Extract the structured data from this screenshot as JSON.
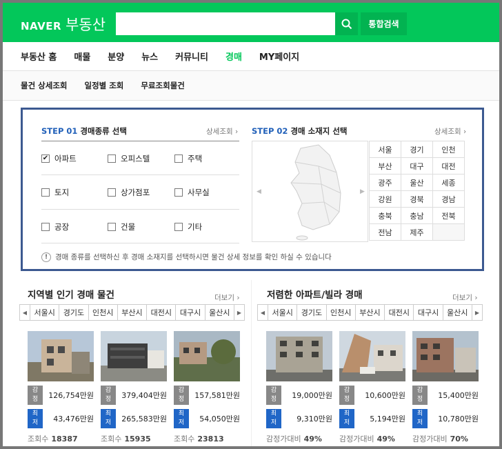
{
  "header": {
    "logo_naver": "NAVER",
    "logo_service": "부동산",
    "search_value": "",
    "search_placeholder": "",
    "integrated_search": "통합검색"
  },
  "gnb": [
    "부동산 홈",
    "매물",
    "분양",
    "뉴스",
    "커뮤니티",
    "경매",
    "MY페이지"
  ],
  "gnb_active": "경매",
  "lnb": [
    "물건 상세조회",
    "일정별 조회",
    "무료조회물건"
  ],
  "step1": {
    "step": "STEP 01",
    "title": "경매종류 선택",
    "more": "상세조회",
    "options": [
      {
        "label": "아파트",
        "checked": true
      },
      {
        "label": "오피스텔",
        "checked": false
      },
      {
        "label": "주택",
        "checked": false
      },
      {
        "label": "토지",
        "checked": false
      },
      {
        "label": "상가점포",
        "checked": false
      },
      {
        "label": "사무실",
        "checked": false
      },
      {
        "label": "공장",
        "checked": false
      },
      {
        "label": "건물",
        "checked": false
      },
      {
        "label": "기타",
        "checked": false
      }
    ]
  },
  "step2": {
    "step": "STEP 02",
    "title": "경매 소재지 선택",
    "more": "상세조회",
    "regions": [
      "서울",
      "경기",
      "인천",
      "부산",
      "대구",
      "대전",
      "광주",
      "울산",
      "세종",
      "강원",
      "경북",
      "경남",
      "충북",
      "충남",
      "전북",
      "전남",
      "제주",
      ""
    ]
  },
  "notice": "경매 종류를 선택하신 후 경매 소재지를 선택하시면 물건 상세 정보를 확인 하실 수 있습니다",
  "labels": {
    "appraisal": "감정",
    "minimum": "최저",
    "views": "조회수",
    "ratio": "감정가대비"
  },
  "popular": {
    "title": "지역별 인기 경매 물건",
    "more": "더보기",
    "tabs": [
      "서울시",
      "경기도",
      "인천시",
      "부산시",
      "대전시",
      "대구시",
      "울산시"
    ],
    "items": [
      {
        "appraisal": "126,754만원",
        "minimum": "43,476만원",
        "stat": "18387"
      },
      {
        "appraisal": "379,404만원",
        "minimum": "265,583만원",
        "stat": "15935"
      },
      {
        "appraisal": "157,581만원",
        "minimum": "54,050만원",
        "stat": "23813"
      }
    ]
  },
  "cheap": {
    "title": "저렴한 아파트/빌라 경매",
    "more": "더보기",
    "tabs": [
      "서울시",
      "경기도",
      "인천시",
      "부산시",
      "대전시",
      "대구시",
      "울산시"
    ],
    "items": [
      {
        "appraisal": "19,000만원",
        "minimum": "9,310만원",
        "stat": "49%"
      },
      {
        "appraisal": "10,600만원",
        "minimum": "5,194만원",
        "stat": "49%"
      },
      {
        "appraisal": "15,400만원",
        "minimum": "10,780만원",
        "stat": "70%"
      }
    ]
  },
  "colors": {
    "brand": "#03c75a",
    "step_border": "#3c5990",
    "step_number": "#2160b9",
    "minimum_tag": "#2066c7"
  }
}
